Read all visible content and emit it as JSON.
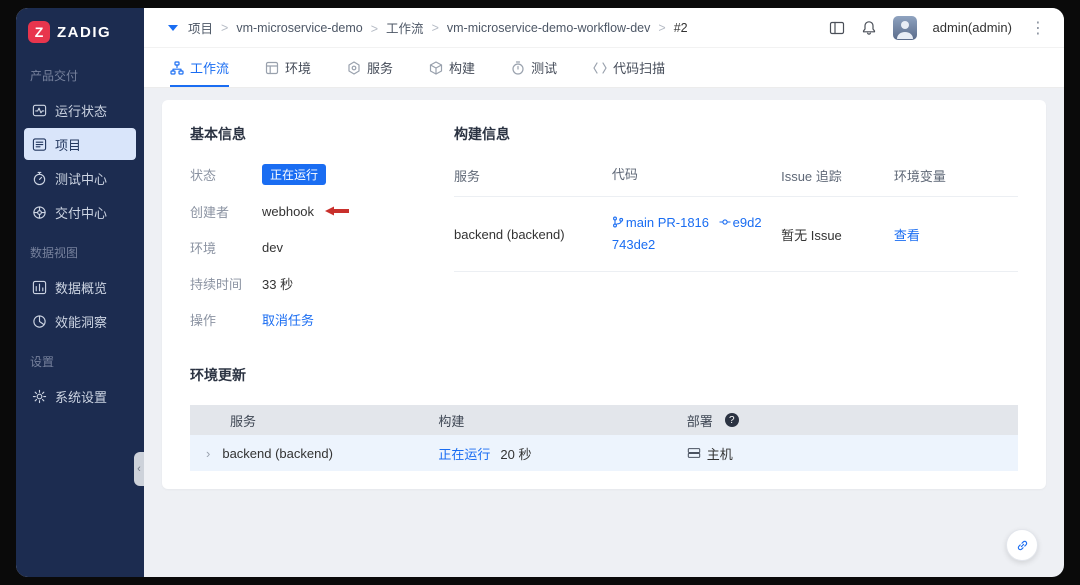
{
  "colors": {
    "accent_blue": "#1a6df2",
    "status_running": "#1a6df2",
    "annotation_red": "#c9302c",
    "sidebar_bg": "#1c2c50",
    "logo_red": "#e8354d"
  },
  "sidebar": {
    "logo_glyph": "Z",
    "logo_text": "ZADIG",
    "sections": [
      {
        "label": "产品交付",
        "items": [
          {
            "label": "运行状态"
          },
          {
            "label": "项目"
          },
          {
            "label": "测试中心"
          },
          {
            "label": "交付中心"
          }
        ]
      },
      {
        "label": "数据视图",
        "items": [
          {
            "label": "数据概览"
          },
          {
            "label": "效能洞察"
          }
        ]
      },
      {
        "label": "设置",
        "items": [
          {
            "label": "系统设置"
          }
        ]
      }
    ]
  },
  "header": {
    "breadcrumb": [
      "项目",
      "vm-microservice-demo",
      "工作流",
      "vm-microservice-demo-workflow-dev",
      "#2"
    ],
    "user": "admin(admin)"
  },
  "tabs": [
    {
      "label": "工作流"
    },
    {
      "label": "环境"
    },
    {
      "label": "服务"
    },
    {
      "label": "构建"
    },
    {
      "label": "测试"
    },
    {
      "label": "代码扫描"
    }
  ],
  "basic_info": {
    "title": "基本信息",
    "status_label": "状态",
    "status_value": "正在运行",
    "creator_label": "创建者",
    "creator_value": "webhook",
    "env_label": "环境",
    "env_value": "dev",
    "duration_label": "持续时间",
    "duration_value": "33 秒",
    "action_label": "操作",
    "action_value": "取消任务"
  },
  "build_info": {
    "title": "构建信息",
    "headers": [
      "服务",
      "代码",
      "Issue 追踪",
      "环境变量"
    ],
    "row": {
      "service": "backend (backend)",
      "branch": "main PR-1816",
      "commit": "e9d2743de2",
      "issue": "暂无 Issue",
      "env_link": "查看"
    }
  },
  "env_update": {
    "title": "环境更新",
    "headers": [
      "服务",
      "构建",
      "部署"
    ],
    "row": {
      "service": "backend (backend)",
      "build_status": "正在运行",
      "build_duration": "20 秒",
      "deploy_target": "主机"
    }
  }
}
